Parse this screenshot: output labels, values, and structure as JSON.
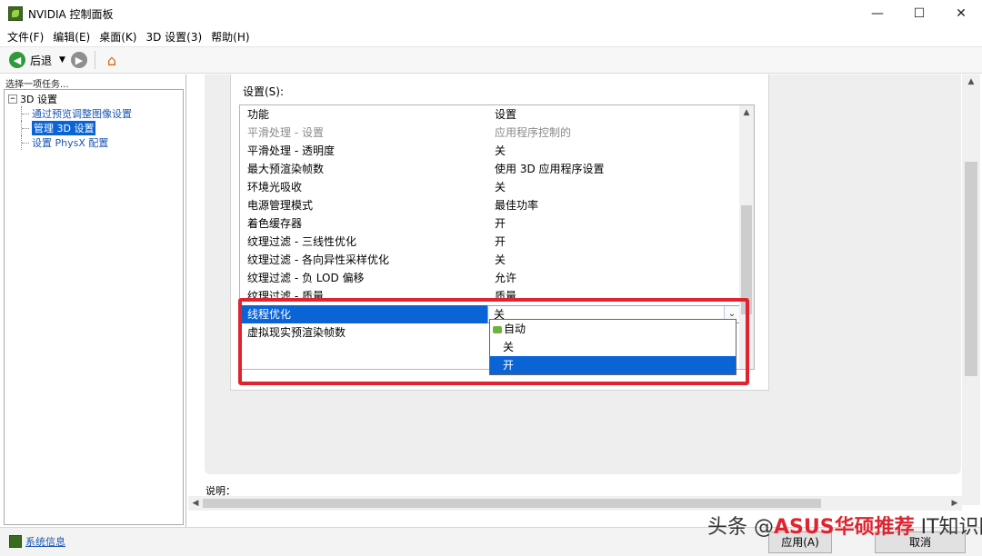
{
  "window": {
    "title": "NVIDIA 控制面板",
    "minimize_glyph": "—",
    "maximize_glyph": "☐",
    "close_glyph": "✕"
  },
  "menu": [
    "文件(F)",
    "编辑(E)",
    "桌面(K)",
    "3D 设置(3)",
    "帮助(H)"
  ],
  "toolbar": {
    "back_label": "后退",
    "back_icon": "back-arrow-icon",
    "forward_icon": "forward-arrow-icon",
    "home_icon": "home-icon"
  },
  "task_pane": {
    "label": "选择一项任务...",
    "root": "3D 设置",
    "root_toggle": "−",
    "children": [
      "通过预览调整图像设置",
      "管理 3D 设置",
      "设置 PhysX 配置"
    ],
    "selected_index": 1
  },
  "settings": {
    "label": "设置(S):",
    "header_feature": "功能",
    "header_setting": "设置",
    "rows": [
      {
        "feature": "平滑处理 - 设置",
        "value": "应用程序控制的",
        "disabled": true
      },
      {
        "feature": "平滑处理 - 透明度",
        "value": "关"
      },
      {
        "feature": "最大预渲染帧数",
        "value": "使用 3D 应用程序设置"
      },
      {
        "feature": "环境光吸收",
        "value": "关"
      },
      {
        "feature": "电源管理模式",
        "value": "最佳功率"
      },
      {
        "feature": "着色缓存器",
        "value": "开"
      },
      {
        "feature": "纹理过滤 - 三线性优化",
        "value": "开"
      },
      {
        "feature": "纹理过滤 - 各向异性采样优化",
        "value": "关"
      },
      {
        "feature": "纹理过滤 - 负 LOD 偏移",
        "value": "允许"
      },
      {
        "feature": "纹理过滤 - 质量",
        "value": "质量"
      },
      {
        "feature": "线程优化",
        "value": "关",
        "selected": true
      },
      {
        "feature": "虚拟现实预渲染帧数",
        "value": ""
      }
    ],
    "dropdown_options": [
      "自动",
      "关",
      "开"
    ],
    "dropdown_highlight_index": 2,
    "highlight_color": "#0a64d6",
    "annotation_color": "#e0232f"
  },
  "description_label": "说明：",
  "status": {
    "sysinfo_label": "系统信息",
    "apply_button": "应用(A)",
    "cancel_button": "取消"
  },
  "watermark": {
    "text_prefix": "头条 @",
    "text_red": "ASUS华硕推荐",
    "text_suffix": "IT知识网"
  }
}
